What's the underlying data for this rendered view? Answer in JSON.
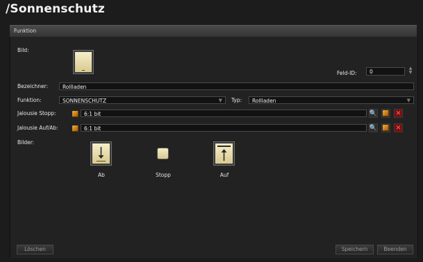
{
  "window": {
    "title": "/Sonnenschutz"
  },
  "section": {
    "label": "Funktion"
  },
  "form": {
    "bild_label": "Bild:",
    "feld_id_label": "Feld-ID:",
    "feld_id_value": "0",
    "bezeichner_label": "Bezeichner:",
    "bezeichner_value": "Rollladen",
    "funktion_label": "Funktion:",
    "funktion_value": "SONNENSCHUTZ",
    "typ_label": "Typ:",
    "typ_value": "Rollladen",
    "jalousie_stopp_label": "Jalousie Stopp:",
    "jalousie_stopp_value": "6:1 bit",
    "jalousie_aufab_label": "Jalousie Auf/Ab:",
    "jalousie_aufab_value": "6:1 bit",
    "bilder_label": "Bilder:"
  },
  "images": [
    {
      "caption": "Ab",
      "icon": "arrow-down-icon"
    },
    {
      "caption": "Stopp",
      "icon": "stop-icon"
    },
    {
      "caption": "Auf",
      "icon": "arrow-up-icon"
    }
  ],
  "footer": {
    "delete_label": "Löschen",
    "save_label": "Speichern",
    "close_label": "Beenden"
  },
  "colors": {
    "background": "#1c1c1c",
    "panel": "#222222",
    "field": "#121212",
    "image_fill": "#eadfb0",
    "delete_red": "#7a1010"
  }
}
